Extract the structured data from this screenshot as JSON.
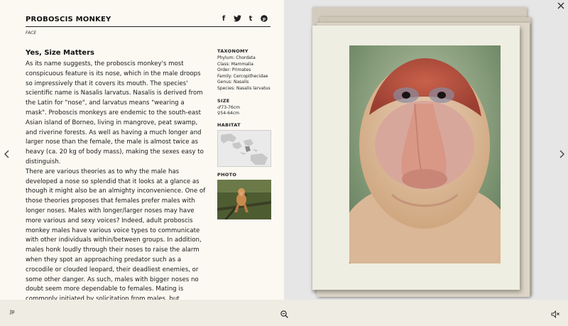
{
  "header": {
    "title": "PROBOSCIS MONKEY",
    "subtitle": "FACE",
    "social": {
      "facebook": "f",
      "twitter": "t",
      "tumblr": "t",
      "pinterest": "p"
    }
  },
  "article": {
    "heading": "Yes, Size Matters",
    "paragraphs": [
      "As its name suggests, the proboscis monkey's most conspicuous feature is its nose, which in the male droops so impressively that it covers its mouth. The species' scientific name is Nasalis larvatus. Nasalis is derived from the Latin for \"nose\", and larvatus means \"wearing a mask\". Proboscis monkeys are endemic to the south-east Asian island of Borneo, living in mangrove, peat swamp, and riverine forests. As well as having a much longer and larger nose than the female, the male is almost twice as heavy (ca. 20 kg of body mass), making the sexes easy to distinguish.",
      "There are various theories as to why the male has developed a nose so splendid that it looks at a glance as though it might also be an almighty inconvenience. One of those theories proposes that females prefer males with longer noses. Males with longer/larger noses may have more various and sexy voices? Indeed, adult proboscis monkey males have various voice types to communicate with other individuals within/between groups. In addition, males honk loudly through their noses to raise the alarm when they spot an approaching predator such as a crocodile or clouded leopard, their deadliest enemies, or some other danger. As such, males with bigger noses no doubt seem more dependable to females. Mating is commonly initiated by solicitation from males, but sometimes females take the initiative. The male pouts and vocalizes as he approaches the female. The female"
    ]
  },
  "sidebar": {
    "taxonomy_label": "TAXONOMY",
    "taxonomy": [
      "Phylum: Chordata",
      "Class: Mammalia",
      "Order: Primates",
      "Family: Cercopithecidae",
      "Genus: Nasalis",
      "Species: Nasalis larvatus"
    ],
    "size_label": "SIZE",
    "size_male": "♂73-76cm",
    "size_female": "♀54-64cm",
    "habitat_label": "HABITAT",
    "photo_label": "PHOTO"
  },
  "navigation": {
    "prev_icon": "chevron-left-icon",
    "next_icon": "chevron-right-icon",
    "close_icon": "close-icon"
  },
  "footer": {
    "language": "Jp",
    "zoom_icon": "zoom-icon",
    "sound_icon": "speaker-icon"
  }
}
